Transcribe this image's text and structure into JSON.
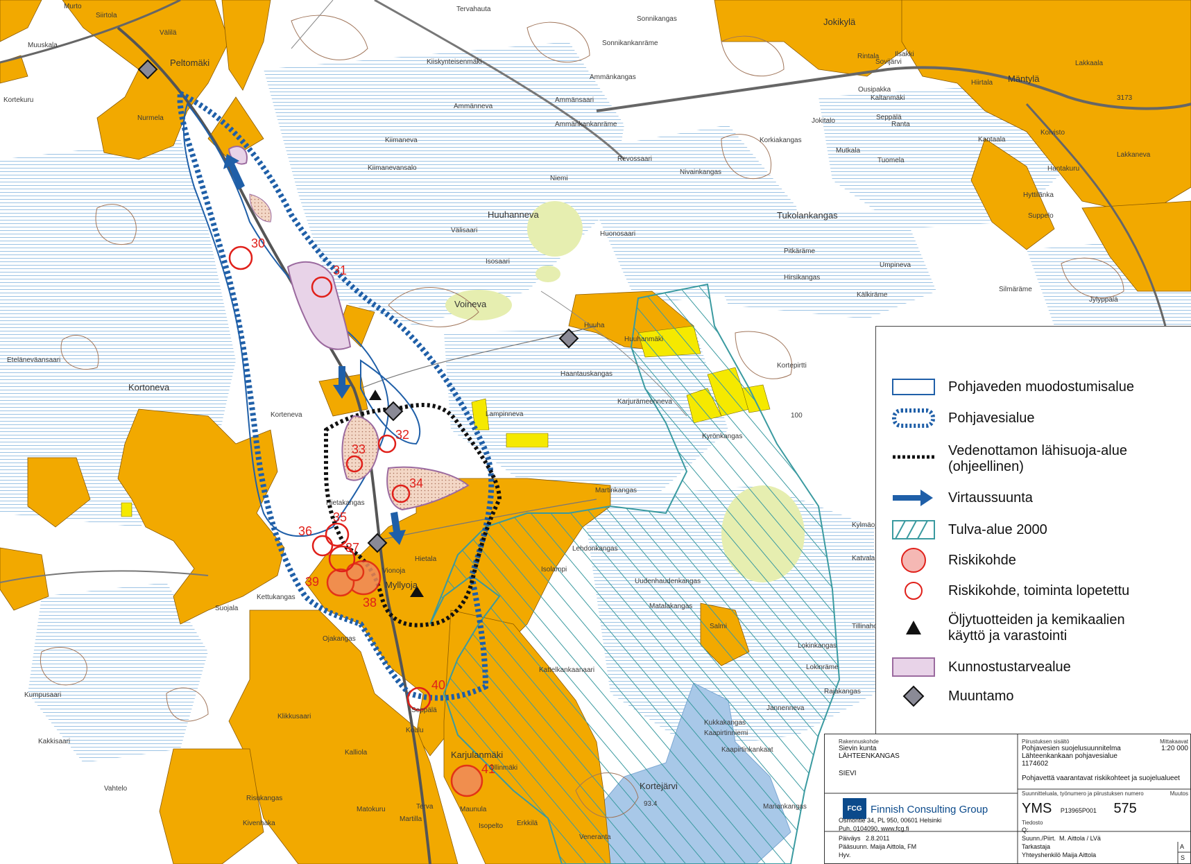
{
  "map": {
    "place_names": [
      "Murto",
      "Siirtola",
      "Välilä",
      "Muuskala",
      "Peltomäki",
      "Kortekuru",
      "Nurmela",
      "Tervahauta",
      "Sonnikangas",
      "Sonnikankanräme",
      "Jokikylä",
      "Ammänkangas",
      "Kiiskynteisenmäki",
      "Ammänneva",
      "Ammänsaari",
      "Ammänkankanräme",
      "Kiimaneva",
      "Kiimanevansalo",
      "Revossaari",
      "Nivainkangas",
      "Korkiakangas",
      "Rintala",
      "Ilsakki",
      "Sovijärvi",
      "Ousipakka",
      "Kaltanmäki",
      "Mäntylä",
      "Seppälä",
      "Ranta",
      "Hiirtala",
      "Kantaala",
      "Koivisto",
      "Lakkaneva",
      "Lakkaala",
      "Jokitalo",
      "Mutkala",
      "Tuomela",
      "Hantakuru",
      "Hyttilänka",
      "Suppelo",
      "Huuhanneva",
      "Niemi",
      "Huonosaari",
      "Välisaari",
      "Isosaari",
      "Voineva",
      "Tukolankangas",
      "Pitkäräme",
      "Hirsikangas",
      "Umpineva",
      "Kälkiräme",
      "Silmäräme",
      "Jylyppälä",
      "Huuhanmäki",
      "Huuha",
      "Haantauskangas",
      "Karjurämeenneva",
      "Kortepirtti",
      "Eteläneväansaari",
      "Kortoneva",
      "Korteneva",
      "Lampinneva",
      "Kyrönkangas",
      "Martinkangas",
      "Hietakangas",
      "Myllyoja",
      "Vionoja",
      "Hietala",
      "Lehdonkangas",
      "Isolampi",
      "Uudenhaudenkangas",
      "Matalakangas",
      "Salmi",
      "Kettukangas",
      "Suojala",
      "Ojakangas",
      "Kattelkankaanaari",
      "Lokinkangas",
      "Lokinräme",
      "Rajakangas",
      "Jannenneva",
      "Kumpusaari",
      "Klikkusaari",
      "Seppälä",
      "Kalliola",
      "Koulu",
      "Karjulanmäki",
      "Kortejärvi",
      "Vahtelo",
      "Risukangas",
      "Kivenhaka",
      "Matokuru",
      "Terva",
      "Martilla",
      "Maunula",
      "Isopelto",
      "Erkkilä",
      "Veneranta",
      "Mariankangas",
      "Kylmäoja",
      "Katvala",
      "Tillinaho",
      "Kukkakangas",
      "Kaapirtinniemi",
      "Kaapirtinkankaat",
      "Ollinmäki",
      "Kakkisaari"
    ],
    "lake_elevation": "93.4",
    "road_number": "3173",
    "contour_label": "100",
    "risk_numbers": [
      "30",
      "31",
      "32",
      "33",
      "34",
      "35",
      "36",
      "37",
      "38",
      "39",
      "40",
      "41"
    ]
  },
  "legend": {
    "items": [
      {
        "key": "formation",
        "label": "Pohjaveden muodostumisalue"
      },
      {
        "key": "groundwater",
        "label": "Pohjavesialue"
      },
      {
        "key": "protection",
        "label": "Vedenottamon lähisuoja-alue\n(ohjeellinen)"
      },
      {
        "key": "flow",
        "label": "Virtaussuunta"
      },
      {
        "key": "flood",
        "label": "Tulva-alue 2000"
      },
      {
        "key": "risk",
        "label": "Riskikohde"
      },
      {
        "key": "risk_ended",
        "label": "Riskikohde, toiminta lopetettu"
      },
      {
        "key": "oil",
        "label": "Öljytuotteiden ja kemikaalien\nkäyttö ja varastointi"
      },
      {
        "key": "remediation",
        "label": "Kunnostustarvealue"
      },
      {
        "key": "substation",
        "label": "Muuntamo"
      }
    ],
    "colors": {
      "blue_line": "#1f5fa8",
      "flow_arrow": "#1f5fa8",
      "flood": "#3a9aa0",
      "risk_fill": "#f5b8b4",
      "risk_stroke": "#e0201a",
      "remediation_fill": "#e8d3e8",
      "remediation_stroke": "#9b6a9f",
      "substation": "#8a8a96",
      "farmland": "#f2a900",
      "wetland_stripe": "#9cc3e4",
      "lake": "#a8c8e8"
    }
  },
  "title_block": {
    "project_label": "Rakennuskohde",
    "municipality": "Sievin kunta",
    "area": "LÄHTEENKANGAS",
    "place": "SIEVI",
    "drawing_content_label": "Piirustuksen sisältö",
    "plan_name": "Pohjavesien suojelusuunnitelma",
    "sub_name": "Lähteenkankaan pohjavesialue",
    "code": "1174602",
    "subject": "Pohjavettä vaarantavat riskikohteet ja suojelualueet",
    "scale_label": "Mittakaavat",
    "scale": "1:20 000",
    "field_label": "Suunnitteluala, työnumero ja piirustuksen numero",
    "change_label": "Muutos",
    "field": "YMS",
    "work_no": "P13965P001",
    "drawing_no": "575",
    "company_logo": "FCG",
    "company": "Finnish Consulting Group",
    "address": "Osmontie 34, PL 950, 00601 Helsinki",
    "contact": "Puh. 0104090, www.fcg.fi",
    "file_label": "Tiedosto",
    "file": "Q:",
    "date_label": "Päiväys",
    "date": "2.8.2011",
    "designer_label": "Suunn./Piirt.",
    "designer": "M. Aittola / LVä",
    "chief_label": "Pääsuunn.",
    "chief": "Maija Aittola, FM",
    "checker_label": "Tarkastaja",
    "approved_label": "Hyv.",
    "contact_person_label": "Yhteyshenkilö",
    "contact_person": "Maija Aittola",
    "rev_a": "A",
    "rev_s": "S"
  }
}
